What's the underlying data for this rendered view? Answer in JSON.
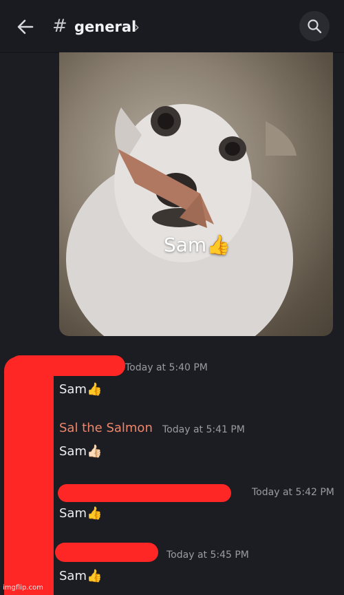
{
  "header": {
    "channel_hash": "#",
    "channel_name": "general",
    "chevron": "›"
  },
  "image_caption": "Sam👍",
  "messages": [
    {
      "author": "",
      "timestamp": "Today at 5:40 PM",
      "text": "Sam👍"
    },
    {
      "author": "Sal the Salmon",
      "timestamp": "Today at 5:41 PM",
      "text": "Sam👍🏻"
    },
    {
      "author": "",
      "timestamp": "Today at 5:42 PM",
      "text": "Sam👍"
    },
    {
      "author": "",
      "timestamp": "Today at 5:45 PM",
      "text": "Sam👍"
    }
  ],
  "watermark": "imgflip.com",
  "colors": {
    "background": "#1c1d22",
    "author_color": "#f0866b",
    "redaction": "#ff2626"
  }
}
